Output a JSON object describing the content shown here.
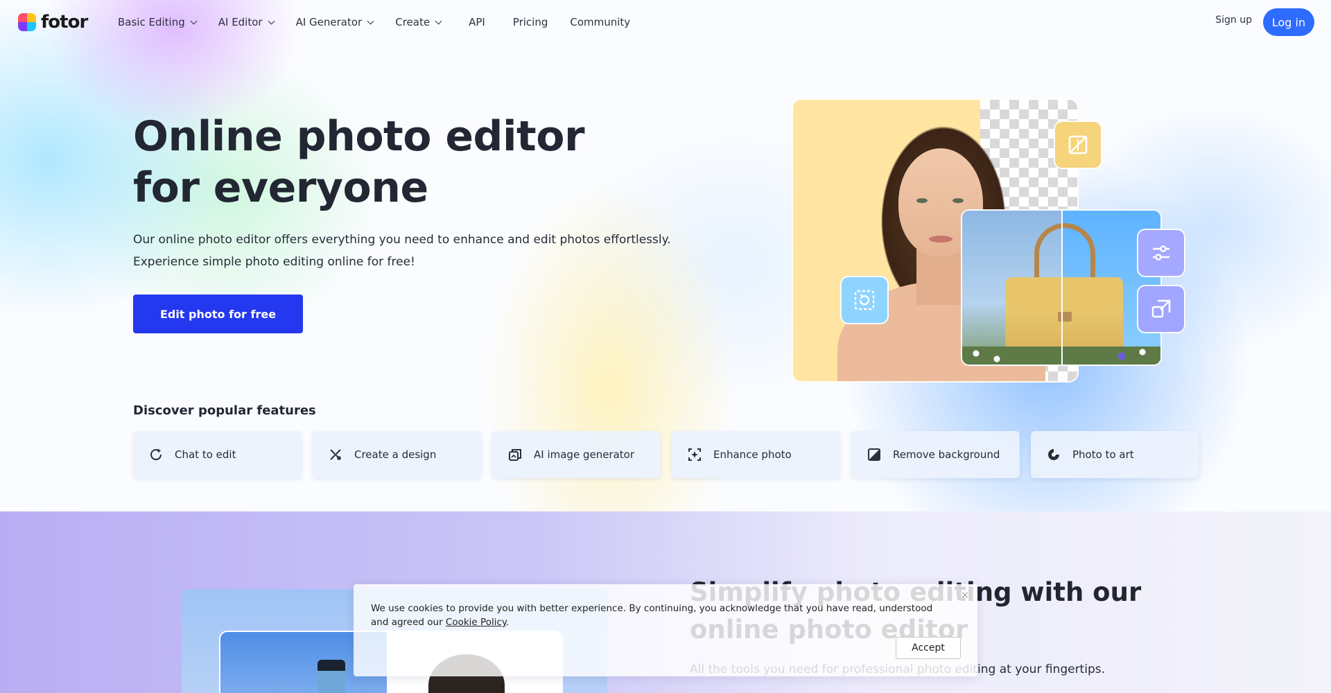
{
  "brand": {
    "name": "fotor"
  },
  "nav": {
    "items": [
      {
        "label": "Basic Editing",
        "dropdown": true
      },
      {
        "label": "AI Editor",
        "dropdown": true
      },
      {
        "label": "AI Generator",
        "dropdown": true
      },
      {
        "label": "Create",
        "dropdown": true
      },
      {
        "label": "API",
        "dropdown": false
      },
      {
        "label": "Pricing",
        "dropdown": false
      },
      {
        "label": "Community",
        "dropdown": false
      }
    ],
    "signup_label": "Sign up",
    "login_label": "Log in"
  },
  "hero": {
    "title": "Online photo editor for everyone",
    "description": "Our online photo editor offers everything you need to enhance and edit photos effortlessly. Experience simple photo editing online for free!",
    "cta_label": "Edit photo for free"
  },
  "features": {
    "title": "Discover popular features",
    "items": [
      {
        "label": "Chat to edit",
        "icon": "chat-edit-icon"
      },
      {
        "label": "Create a design",
        "icon": "design-tools-icon"
      },
      {
        "label": "AI image generator",
        "icon": "ai-image-icon"
      },
      {
        "label": "Enhance photo",
        "icon": "enhance-icon"
      },
      {
        "label": "Remove background",
        "icon": "remove-bg-icon"
      },
      {
        "label": "Photo to art",
        "icon": "photo-art-icon"
      }
    ]
  },
  "section2": {
    "title": "Simplify photo editing with our online photo editor",
    "description": "All the tools you need for professional photo editing at your fingertips."
  },
  "cookie": {
    "text_before_link": "We use cookies to provide you with better experience. By continuing, you acknowledge that you have read, understood and agreed our ",
    "link_label": "Cookie Policy",
    "text_after_link": ".",
    "accept_label": "Accept",
    "close_label": "×"
  },
  "colors": {
    "primary_cta": "#2438ef",
    "login_button": "#2e6bff"
  }
}
